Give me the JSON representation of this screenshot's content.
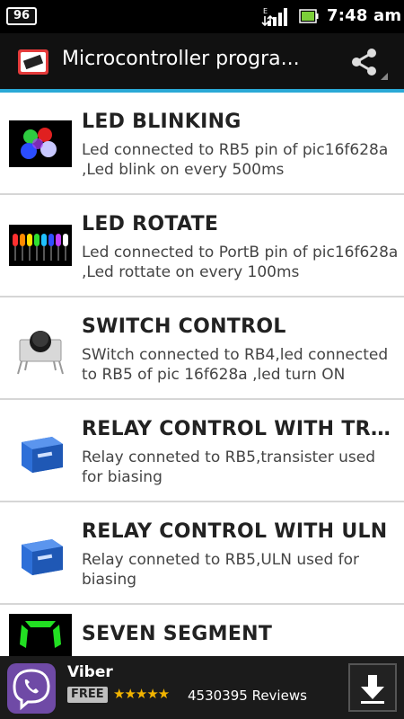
{
  "status_bar": {
    "notification_badge": "96",
    "time": "7:48 am",
    "icons": [
      "data-transfer-icon",
      "signal-icon",
      "battery-icon"
    ]
  },
  "action_bar": {
    "title": "Microcontroller progra...",
    "app_icon": "chip-icon",
    "share_icon": "share-icon",
    "accent_color": "#2aa9d6"
  },
  "items": [
    {
      "title": "LED BLINKING",
      "desc": "Led connected to RB5 pin of pic16f628a ,Led blink on every 500ms",
      "thumb": "led-cluster-image"
    },
    {
      "title": "LED ROTATE",
      "desc": "Led connected to PortB pin of pic16f628a ,Led rottate on every 100ms",
      "thumb": "led-row-image"
    },
    {
      "title": "SWITCH CONTROL",
      "desc": "SWitch connected to RB4,led connected to RB5 of pic 16f628a ,led turn ON",
      "thumb": "push-button-image"
    },
    {
      "title": "RELAY CONTROL WITH TRA...",
      "desc": "Relay conneted to RB5,transister used for biasing",
      "thumb": "relay-image"
    },
    {
      "title": "RELAY CONTROL WITH ULN",
      "desc": "Relay conneted to RB5,ULN used for biasing",
      "thumb": "relay-image"
    },
    {
      "title": "SEVEN SEGMENT",
      "desc": "",
      "thumb": "seven-segment-image"
    }
  ],
  "ad": {
    "title": "Viber",
    "badge": "FREE",
    "stars": "★★★★★",
    "rating": 4.5,
    "reviews": "4530395 Reviews",
    "icon": "viber-icon",
    "download_icon": "download-arrow-icon"
  }
}
